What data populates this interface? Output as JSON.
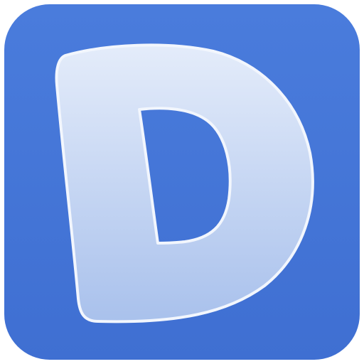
{
  "icon": {
    "name": "dash-app-icon",
    "logo_letter": "D",
    "colors": {
      "background": "#4a7cdc",
      "background_edge": "#3f6fd2",
      "letter_top": "#e4ecfa",
      "letter_bottom": "#a9c1ec",
      "letter_outline": "#f2f6fd",
      "counter": "#4a7cdc"
    }
  }
}
